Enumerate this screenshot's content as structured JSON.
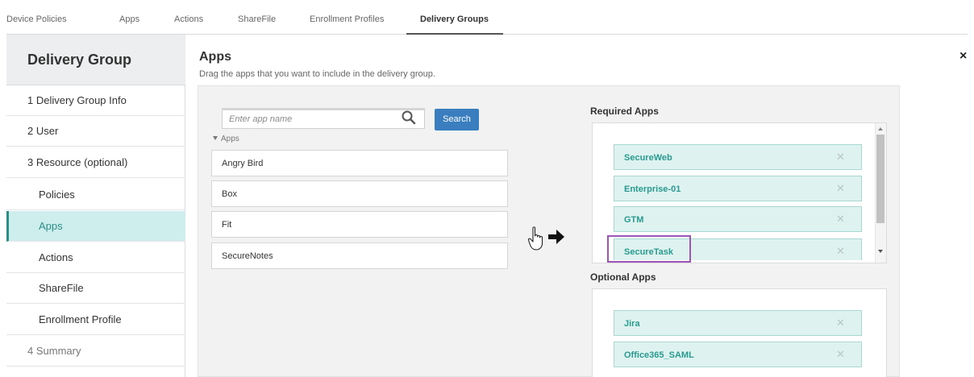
{
  "top_tabs": [
    {
      "label": "Device Policies"
    },
    {
      "label": "Apps"
    },
    {
      "label": "Actions"
    },
    {
      "label": "ShareFile"
    },
    {
      "label": "Enrollment Profiles"
    },
    {
      "label": "Delivery Groups",
      "active": true
    }
  ],
  "sidebar": {
    "title": "Delivery Group",
    "items": [
      {
        "label": "1 Delivery Group Info"
      },
      {
        "label": "2 User"
      },
      {
        "label": "3 Resource (optional)"
      },
      {
        "label": "Policies"
      },
      {
        "label": "Apps",
        "active": true
      },
      {
        "label": "Actions"
      },
      {
        "label": "ShareFile"
      },
      {
        "label": "Enrollment Profile"
      },
      {
        "label": "4 Summary"
      }
    ]
  },
  "main": {
    "title": "Apps",
    "subtitle": "Drag the apps that you want to include in the delivery group.",
    "close_label": "×"
  },
  "search": {
    "placeholder": "Enter app name",
    "button_label": "Search"
  },
  "available": {
    "toggle_label": "Apps",
    "items": [
      "Angry Bird",
      "Box",
      "Fit",
      "SecureNotes"
    ]
  },
  "required": {
    "title": "Required Apps",
    "items": [
      "SecureWeb",
      "Enterprise-01",
      "GTM",
      "SecureTask"
    ]
  },
  "optional": {
    "title": "Optional Apps",
    "items": [
      "Jira",
      "Office365_SAML"
    ]
  },
  "remove_glyph": "✕",
  "colors": {
    "accent_teal": "#2c8d87",
    "chip_bg": "#def2f0",
    "button_blue": "#3a7ebf",
    "highlight_purple": "#a154b7"
  }
}
